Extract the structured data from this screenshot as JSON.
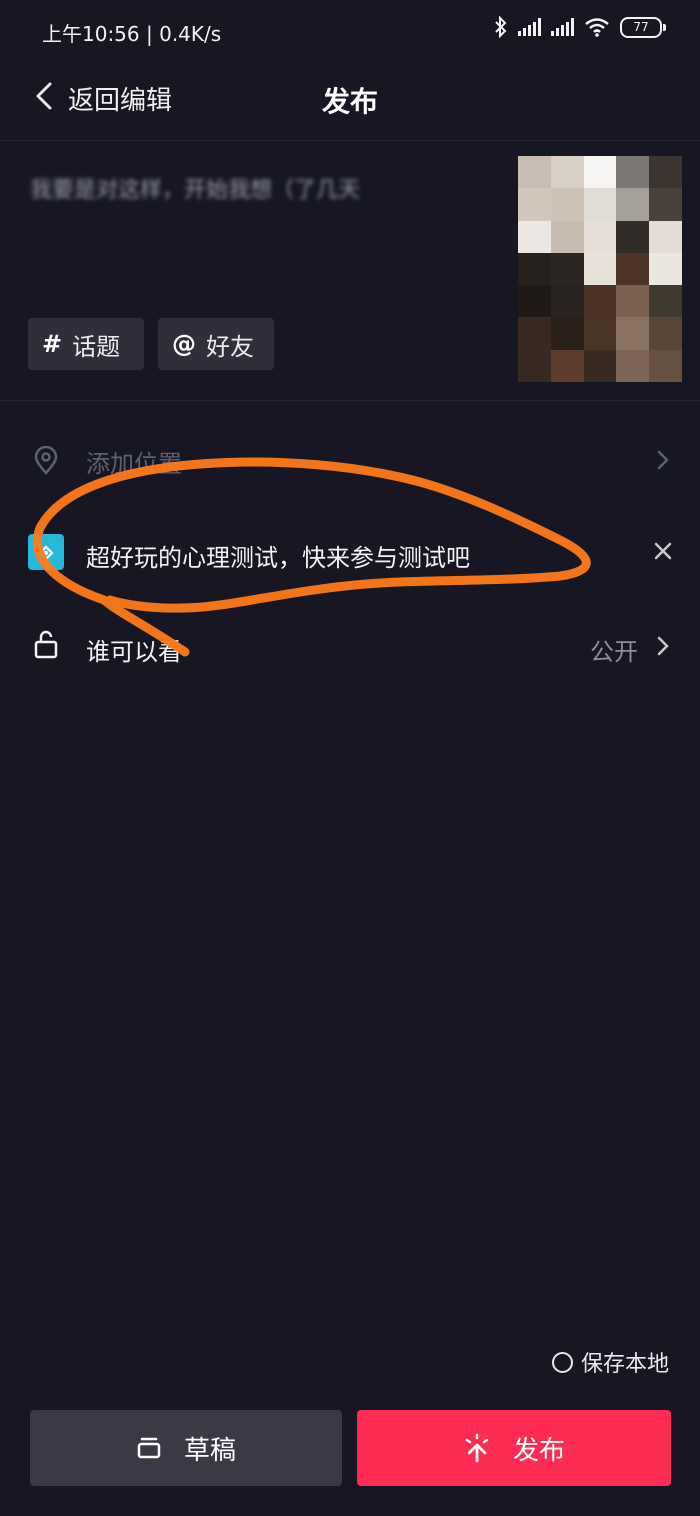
{
  "status_bar": {
    "time": "上午10:56 | 0.4K/s",
    "battery": "77",
    "icons": [
      "bluetooth-icon",
      "signal-icon",
      "signal-icon",
      "wifi-icon",
      "battery-icon"
    ]
  },
  "nav": {
    "back_label": "返回编辑",
    "title": "发布"
  },
  "caption": {
    "text": "我要是对这样，开始我想（了几天"
  },
  "chips": {
    "topic": {
      "symbol": "#",
      "label": "话题"
    },
    "friend": {
      "symbol": "@",
      "label": "好友"
    }
  },
  "rows": {
    "location": {
      "label": "添加位置",
      "icon": "location-pin-icon"
    },
    "mini_program": {
      "label": "超好玩的心理测试，快来参与测试吧",
      "icon": "mini-program-icon"
    },
    "privacy": {
      "label": "谁可以看",
      "value": "公开",
      "icon": "lock-icon"
    }
  },
  "save_local": {
    "label": "保存本地",
    "checked": false
  },
  "buttons": {
    "draft": "草稿",
    "publish": "发布"
  },
  "colors": {
    "background": "#161722",
    "publish": "#fe2c55",
    "draft": "#393a45",
    "annotation": "#ff7a1a",
    "mini_icon": "#25b8d8"
  }
}
